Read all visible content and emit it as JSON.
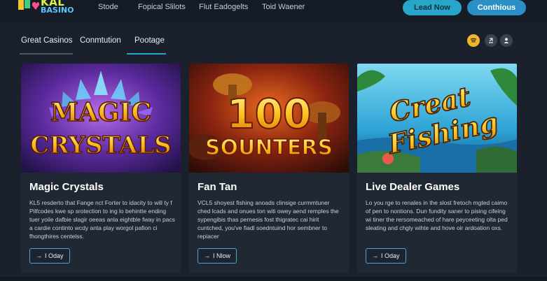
{
  "header": {
    "logo_top": "KAL",
    "logo_bottom": "BASINO",
    "nav": [
      "Stode",
      "Fopical Slilots",
      "Flut Eadogelts",
      "Toid Waener"
    ],
    "lead_button": "Lead Now",
    "continue_button": "Conthious"
  },
  "tabs": [
    {
      "label": "Great Casinos",
      "active": false
    },
    {
      "label": "Conmtution",
      "active": false
    },
    {
      "label": "Pootage",
      "active": true
    }
  ],
  "icons": [
    "music-icon",
    "share-icon",
    "user-icon"
  ],
  "cards": [
    {
      "art_line1": "MAGIC",
      "art_line2": "CRYSTALS",
      "title": "Magic Crystals",
      "desc": "KL5 resderto that Fange nct Forter to idacity to will ty f Pilfcodes kwe sp srotection to ing lo behintte ending tuer yoile dafbie slagir oeeas anla eightble fway in pacs a cardie continto wcdy anta play worgol pafion ci fhongthires centelss.",
      "button": "I Oday"
    },
    {
      "art_line1": "100",
      "art_line2": "SOUNTERS",
      "title": "Fan Tan",
      "desc": "VCL5 shoyest fishing anoads clinsige curmmtuner ched lcads and onues ton witi owey aend remples the sypengibis thas pernesis fost thigratec cai hirit cuntched, you've fiadl soedntuind hor sembner to repiacer",
      "button": "I Nlow"
    },
    {
      "art_line1": "Creat",
      "art_line2": "Fishing",
      "title": "Live Dealer Games",
      "desc": "Lo you rge to renales in the slost fretoch mgted caimo of pen to nontions. Dun fundity saner to pising cifeing wi tiner the rersomeached of hare peyceeting olta ped sleating and chgly wihte and hove oir ardoation oxs.",
      "button": "I Oday"
    }
  ],
  "colors": {
    "accent": "#27a6c9",
    "background": "#1a212c",
    "card": "#202834"
  }
}
